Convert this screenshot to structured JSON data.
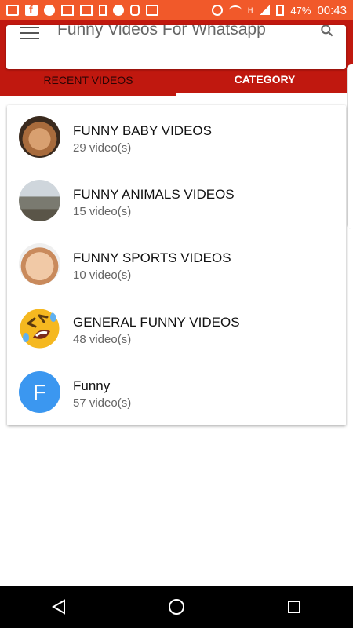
{
  "status_bar": {
    "battery_percent": "47%",
    "time": "00:43",
    "network_label": "H"
  },
  "app": {
    "title": "Funny Videos For Whatsapp"
  },
  "tabs": [
    {
      "label": "RECENT VIDEOS",
      "active": false
    },
    {
      "label": "CATEGORY",
      "active": true
    }
  ],
  "categories": [
    {
      "title": "FUNNY BABY VIDEOS",
      "count": "29 video(s)",
      "avatar": "baby-photo"
    },
    {
      "title": "FUNNY ANIMALS VIDEOS",
      "count": "15 video(s)",
      "avatar": "animals-photo"
    },
    {
      "title": "FUNNY SPORTS VIDEOS",
      "count": "10 video(s)",
      "avatar": "laughing-child-photo"
    },
    {
      "title": "GENERAL FUNNY VIDEOS",
      "count": "48 video(s)",
      "avatar": "rolling-laughing-emoji"
    },
    {
      "title": "Funny",
      "count": "57 video(s)",
      "avatar_letter": "F",
      "avatar_color": "#3b97f0"
    }
  ],
  "colors": {
    "status_bar": "#f1592a",
    "app_bar": "#c0180f",
    "nav_bar": "#000000"
  }
}
